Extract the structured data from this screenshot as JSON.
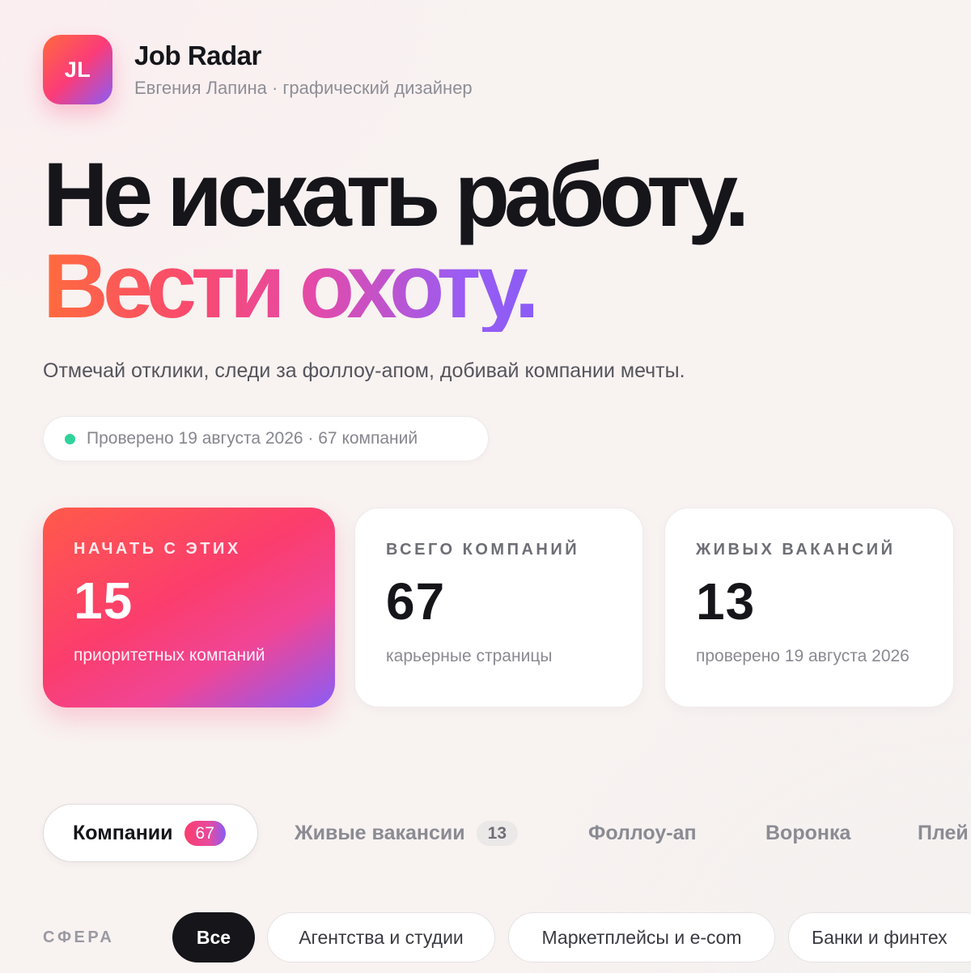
{
  "header": {
    "logo_text": "JL",
    "title": "Job Radar",
    "subtitle": "Евгения Лапина · графический дизайнер"
  },
  "hero": {
    "line1": "Не искать работу.",
    "line2": "Вести охоту.",
    "tagline": "Отмечай отклики, следи за фоллоу-апом, добивай компании мечты."
  },
  "status": {
    "text": "Проверено 19 августа 2026 · 67 компаний",
    "dot_color": "#2fd39a"
  },
  "stats": [
    {
      "label": "НАЧАТЬ С ЭТИХ",
      "value": "15",
      "caption": "приоритетных компаний"
    },
    {
      "label": "ВСЕГО КОМПАНИЙ",
      "value": "67",
      "caption": "карьерные страницы"
    },
    {
      "label": "ЖИВЫХ ВАКАНСИЙ",
      "value": "13",
      "caption": "проверено 19 августа 2026"
    }
  ],
  "tabs": [
    {
      "label": "Компании",
      "count": "67",
      "active": true
    },
    {
      "label": "Живые вакансии",
      "count": "13",
      "active": false
    },
    {
      "label": "Фоллоу-ап",
      "active": false
    },
    {
      "label": "Воронка",
      "active": false
    },
    {
      "label": "Плей",
      "active": false
    }
  ],
  "filters": {
    "label": "СФЕРА",
    "chips": [
      {
        "label": "Все",
        "active": true
      },
      {
        "label": "Агентства и студии",
        "active": false
      },
      {
        "label": "Маркетплейсы и e-com",
        "active": false
      },
      {
        "label": "Банки и финтех",
        "active": false
      }
    ]
  },
  "colors": {
    "accent_orange": "#ff6a3d",
    "accent_pink": "#fb3c78",
    "accent_purple": "#8a5cf6",
    "text_dark": "#15151a",
    "status_green": "#2fd39a"
  }
}
